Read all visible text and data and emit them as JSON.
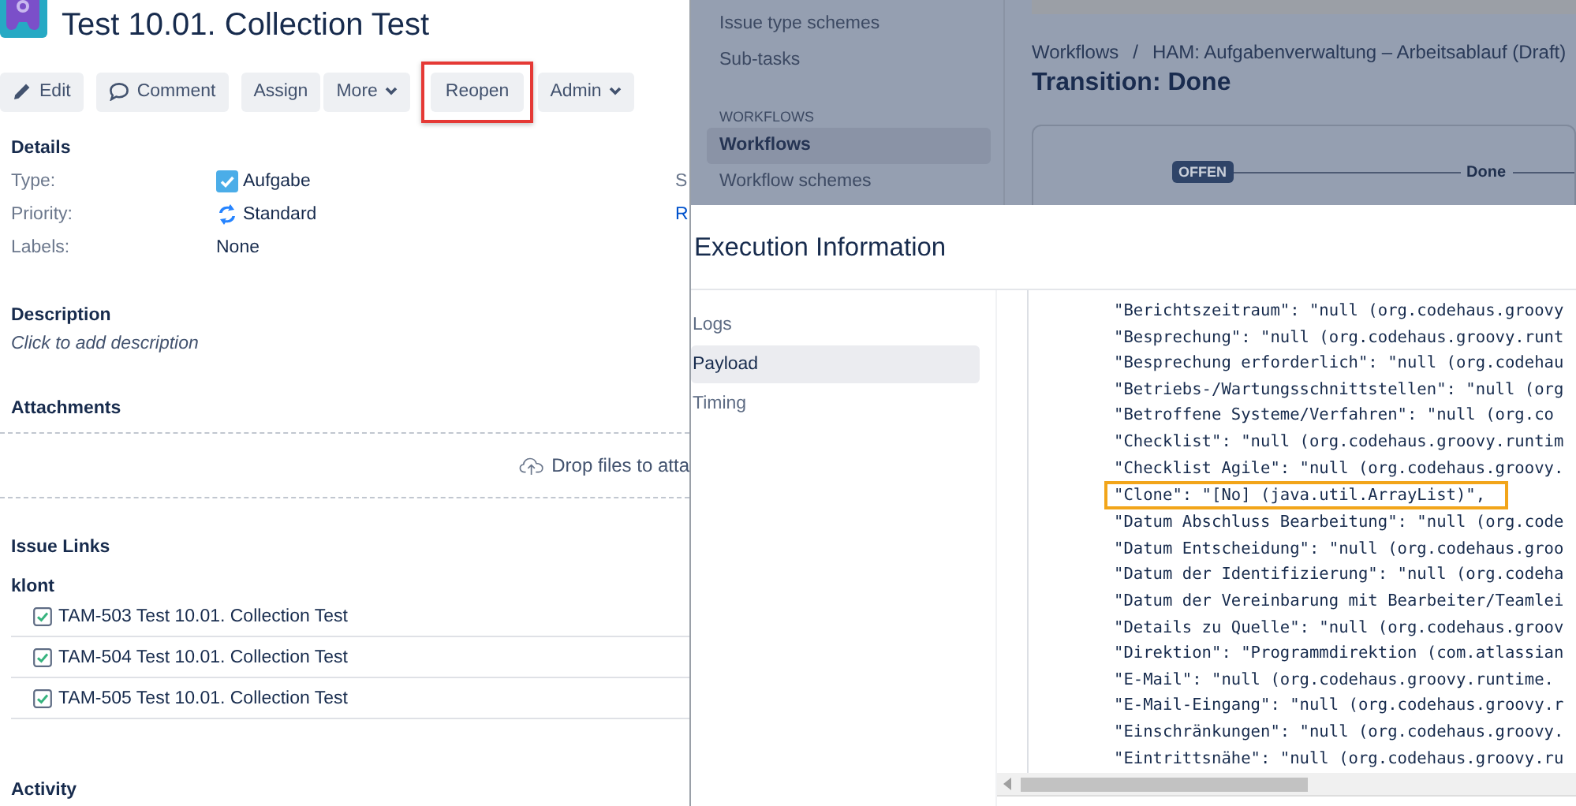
{
  "issue": {
    "title": "Test 10.01. Collection Test",
    "actions": [
      {
        "label": "Edit",
        "kind": "edit",
        "highlighted": false
      },
      {
        "label": "Comment",
        "kind": "comment",
        "highlighted": false
      },
      {
        "label": "Assign",
        "kind": "plain",
        "highlighted": false
      },
      {
        "label": "More",
        "kind": "dropdown",
        "highlighted": false
      },
      {
        "label": "Reopen",
        "kind": "plain",
        "highlighted": true
      },
      {
        "label": "Admin",
        "kind": "dropdown",
        "highlighted": false
      }
    ],
    "details": {
      "heading": "Details",
      "fields": [
        {
          "label": "Type:",
          "value": "Aufgabe",
          "kind": "issue_type",
          "side_label": "S"
        },
        {
          "label": "Priority:",
          "value": "Standard",
          "kind": "priority",
          "side_label": "R"
        },
        {
          "label": "Labels:",
          "value": "None",
          "kind": "text"
        }
      ]
    },
    "description": {
      "heading": "Description",
      "prompt": "Click to add description"
    },
    "attachments": {
      "heading": "Attachments",
      "drop_text": "Drop files to atta"
    },
    "issue_links": {
      "heading": "Issue Links",
      "group": "klont",
      "links": [
        {
          "text": "TAM-503 Test 10.01. Collection Test"
        },
        {
          "text": "TAM-504 Test 10.01. Collection Test"
        },
        {
          "text": "TAM-505 Test 10.01. Collection Test"
        }
      ]
    },
    "activity": {
      "heading": "Activity"
    }
  },
  "admin": {
    "sidebar": {
      "items": [
        {
          "label": "Issue type schemes",
          "kind": "item",
          "selected": false
        },
        {
          "label": "Sub-tasks",
          "kind": "item",
          "selected": false
        },
        {
          "label": "WORKFLOWS",
          "kind": "heading"
        },
        {
          "label": "Workflows",
          "kind": "item",
          "selected": true
        },
        {
          "label": "Workflow schemes",
          "kind": "item",
          "selected": false
        }
      ]
    },
    "breadcrumb": [
      "Workflows",
      "HAM: Aufgabenverwaltung – Arbeitsablauf (Draft)"
    ],
    "breadcrumb_separator": "/",
    "title": "Transition: Done",
    "diagram": {
      "status": "OFFEN",
      "transition": "Done"
    }
  },
  "modal": {
    "title": "Execution Information",
    "tabs": [
      {
        "label": "Logs",
        "selected": false
      },
      {
        "label": "Payload",
        "selected": true
      },
      {
        "label": "Timing",
        "selected": false
      }
    ],
    "payload_lines": [
      {
        "text": "\"Berichtszeitraum\": \"null (org.codehaus.groovy",
        "highlighted": false
      },
      {
        "text": "\"Besprechung\": \"null (org.codehaus.groovy.runt",
        "highlighted": false
      },
      {
        "text": "\"Besprechung erforderlich\": \"null (org.codehau",
        "highlighted": false
      },
      {
        "text": "\"Betriebs-/Wartungsschnittstellen\": \"null (org",
        "highlighted": false
      },
      {
        "text": "\"Betroffene Systeme/Verfahren\": \"null (org.co",
        "highlighted": false
      },
      {
        "text": "\"Checklist\": \"null (org.codehaus.groovy.runtim",
        "highlighted": false
      },
      {
        "text": "\"Checklist Agile\": \"null (org.codehaus.groovy.",
        "highlighted": false
      },
      {
        "text": "\"Clone\": \"[No] (java.util.ArrayList)\",",
        "highlighted": true
      },
      {
        "text": "\"Datum Abschluss Bearbeitung\": \"null (org.code",
        "highlighted": false
      },
      {
        "text": "\"Datum Entscheidung\": \"null (org.codehaus.groo",
        "highlighted": false
      },
      {
        "text": "\"Datum der Identifizierung\": \"null (org.codeha",
        "highlighted": false
      },
      {
        "text": "\"Datum der Vereinbarung mit Bearbeiter/Teamlei",
        "highlighted": false
      },
      {
        "text": "\"Details zu Quelle\": \"null (org.codehaus.groov",
        "highlighted": false
      },
      {
        "text": "\"Direktion\": \"Programmdirektion (com.atlassian",
        "highlighted": false
      },
      {
        "text": "\"E-Mail\": \"null (org.codehaus.groovy.runtime.",
        "highlighted": false
      },
      {
        "text": "\"E-Mail-Eingang\": \"null (org.codehaus.groovy.r",
        "highlighted": false
      },
      {
        "text": "\"Einschränkungen\": \"null (org.codehaus.groovy.",
        "highlighted": false
      },
      {
        "text": "\"Eintrittsnähe\": \"null (org.codehaus.groovy.ru",
        "highlighted": false
      }
    ]
  }
}
